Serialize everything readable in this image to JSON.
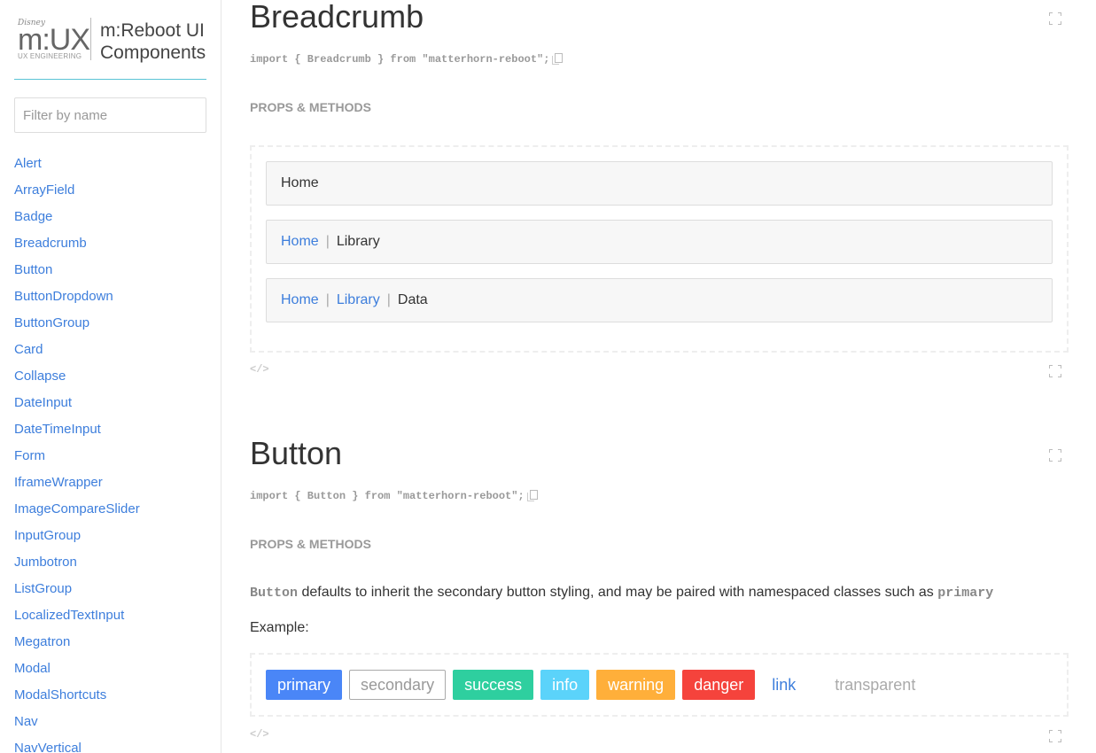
{
  "sidebar": {
    "brand": {
      "disney": "Disney",
      "mux_m": "m:",
      "mux_ux": "UX",
      "ux_engineering": "UX ENGINEERING",
      "title_line1": "m:Reboot UI",
      "title_line2": "Components"
    },
    "filter_placeholder": "Filter by name",
    "items": [
      "Alert",
      "ArrayField",
      "Badge",
      "Breadcrumb",
      "Button",
      "ButtonDropdown",
      "ButtonGroup",
      "Card",
      "Collapse",
      "DateInput",
      "DateTimeInput",
      "Form",
      "IframeWrapper",
      "ImageCompareSlider",
      "InputGroup",
      "Jumbotron",
      "ListGroup",
      "LocalizedTextInput",
      "Megatron",
      "Modal",
      "ModalShortcuts",
      "Nav",
      "NavVertical"
    ]
  },
  "breadcrumb_section": {
    "title": "Breadcrumb",
    "import": "import { Breadcrumb } from \"matterhorn-reboot\";",
    "props_heading": "PROPS & METHODS",
    "examples": {
      "row1": {
        "current": "Home"
      },
      "row2": {
        "link1": "Home",
        "current": "Library"
      },
      "row3": {
        "link1": "Home",
        "link2": "Library",
        "current": "Data"
      }
    },
    "separator": "|",
    "code_toggle": "</>"
  },
  "button_section": {
    "title": "Button",
    "import": "import { Button } from \"matterhorn-reboot\";",
    "props_heading": "PROPS & METHODS",
    "description_code": "Button",
    "description_text": " defaults to inherit the secondary button styling, and may be paired with namespaced classes such as ",
    "description_code2": "primary",
    "example_label": "Example:",
    "buttons": {
      "primary": "primary",
      "secondary": "secondary",
      "success": "success",
      "info": "info",
      "warning": "warning",
      "danger": "danger",
      "link": "link",
      "transparent": "transparent"
    },
    "code_toggle": "</>"
  }
}
